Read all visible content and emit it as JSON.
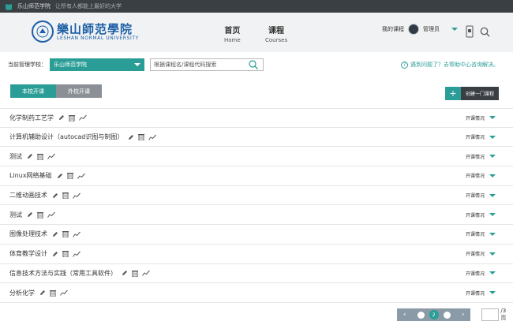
{
  "topbar": {
    "school": "乐山师范学院",
    "slogan": "让所有人都能上最好的大学"
  },
  "logo": {
    "cn": "樂山師范學院",
    "en": "LESHAN NORMAL UNIVERSITY"
  },
  "nav": [
    {
      "cn": "首页",
      "en": "Home"
    },
    {
      "cn": "课程",
      "en": "Courses"
    }
  ],
  "user": {
    "my_courses": "我的课程",
    "role": "管理员"
  },
  "filter": {
    "label": "当前管理学校：",
    "selected": "乐山师范学院"
  },
  "search": {
    "placeholder": "根据课程名/课程代码搜索"
  },
  "help": {
    "text": "遇到问题了？去帮助中心咨询解决。"
  },
  "tabs": [
    "本校开课",
    "外校开课"
  ],
  "create": {
    "label": "创建一门课程",
    "plus": "+"
  },
  "courses": [
    {
      "name": "化学制药工艺学",
      "status": "开课情况"
    },
    {
      "name": "计算机辅助设计（autocad识图与制图）",
      "status": "开课情况"
    },
    {
      "name": "测试",
      "status": "开课情况"
    },
    {
      "name": "Linux网络基础",
      "status": "开课情况"
    },
    {
      "name": "二维动画技术",
      "status": "开课情况"
    },
    {
      "name": "测试",
      "status": "开课情况"
    },
    {
      "name": "图像处理技术",
      "status": "开课情况"
    },
    {
      "name": "体育教学设计",
      "status": "开课情况"
    },
    {
      "name": "信息技术方法与实践（常用工具软件）",
      "status": "开课情况"
    },
    {
      "name": "分析化学",
      "status": "开课情况"
    }
  ],
  "pager": {
    "current": "2",
    "total": "/3 页",
    "prev": "‹",
    "next": "›"
  },
  "colors": {
    "accent": "#2a9d96",
    "dark": "#3a3f44",
    "brand": "#1c5fa6"
  }
}
